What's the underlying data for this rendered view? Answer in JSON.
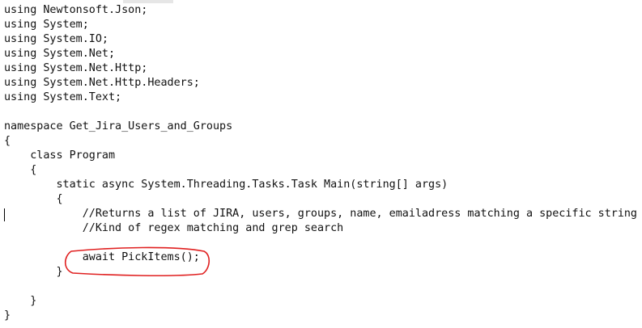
{
  "editor": {
    "lines": [
      "using Newtonsoft.Json;",
      "using System;",
      "using System.IO;",
      "using System.Net;",
      "using System.Net.Http;",
      "using System.Net.Http.Headers;",
      "using System.Text;",
      "",
      "namespace Get_Jira_Users_and_Groups",
      "{",
      "    class Program",
      "    {",
      "        static async System.Threading.Tasks.Task Main(string[] args)",
      "        {",
      "            //Returns a list of JIRA, users, groups, name, emailadress matching a specific string",
      "            //Kind of regex matching and grep search",
      "",
      "            await PickItems();",
      "        }",
      "",
      "    }",
      "}"
    ],
    "annotation_color": "#e02020"
  }
}
